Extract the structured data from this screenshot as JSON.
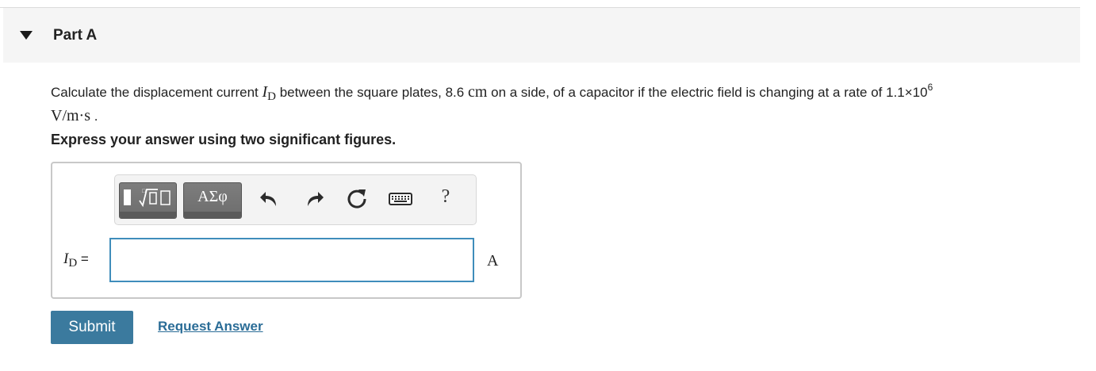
{
  "part": {
    "title": "Part A"
  },
  "question": {
    "prefix": "Calculate the displacement current ",
    "symbol_main": "I",
    "symbol_sub": "D",
    "middle1": " between the square plates, 8.6 ",
    "length_unit": "cm",
    "middle2": " on a side, of a capacitor if the electric field is changing at a rate of 1.1×10",
    "exponent": "6",
    "rate_unit": "V/m·s",
    "end": " ."
  },
  "instruction": "Express your answer using two significant figures.",
  "toolbar": {
    "greek_label": "ΑΣφ",
    "help_label": "?"
  },
  "answer": {
    "label_main": "I",
    "label_sub": "D",
    "equals": " =",
    "value": "",
    "units": "A"
  },
  "actions": {
    "submit_label": "Submit",
    "request_label": "Request Answer"
  },
  "colors": {
    "submit_bg": "#3b7a9e",
    "link": "#2b6d97",
    "input_border": "#3f8dbb",
    "header_bg": "#f5f5f5"
  },
  "icons": [
    "collapse-triangle-icon",
    "templates-icon",
    "undo-icon",
    "redo-icon",
    "reset-icon",
    "keyboard-icon"
  ]
}
